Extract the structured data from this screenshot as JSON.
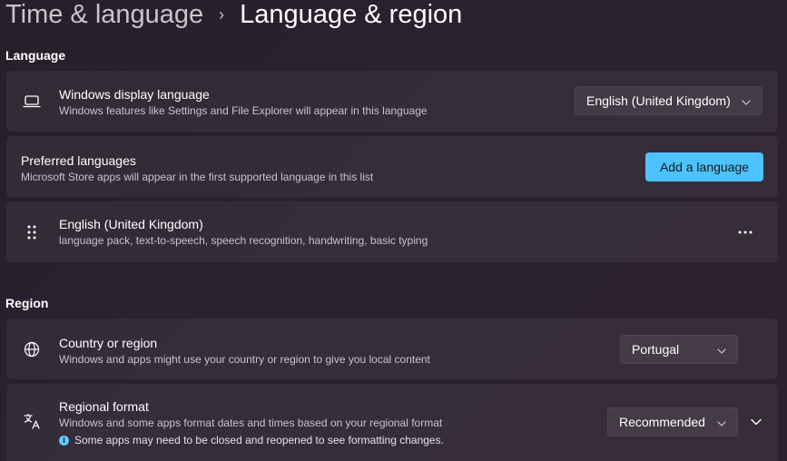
{
  "breadcrumb": {
    "parent": "Time & language",
    "separator": "›",
    "current": "Language & region"
  },
  "sections": {
    "language": "Language",
    "region": "Region"
  },
  "display_language": {
    "icon": "laptop-icon",
    "title": "Windows display language",
    "subtitle": "Windows features like Settings and File Explorer will appear in this language",
    "selected": "English (United Kingdom)"
  },
  "preferred_languages": {
    "title": "Preferred languages",
    "subtitle": "Microsoft Store apps will appear in the first supported language in this list",
    "add_button": "Add a language"
  },
  "language_item": {
    "icon": "drag-handle-icon",
    "title": "English (United Kingdom)",
    "subtitle": "language pack, text-to-speech, speech recognition, handwriting, basic typing",
    "more_icon": "more-options-icon"
  },
  "country_region": {
    "icon": "globe-icon",
    "title": "Country or region",
    "subtitle": "Windows and apps might use your country or region to give you local content",
    "selected": "Portugal"
  },
  "regional_format": {
    "icon": "regional-format-icon",
    "title": "Regional format",
    "subtitle": "Windows and some apps format dates and times based on your regional format",
    "note_icon": "info-icon",
    "note_glyph": "i",
    "note": "Some apps may need to be closed and reopened to see formatting changes.",
    "selected": "Recommended",
    "expand_icon": "chevron-down-icon"
  },
  "colors": {
    "accent": "#4cc2ff",
    "info": "#60cdff"
  }
}
